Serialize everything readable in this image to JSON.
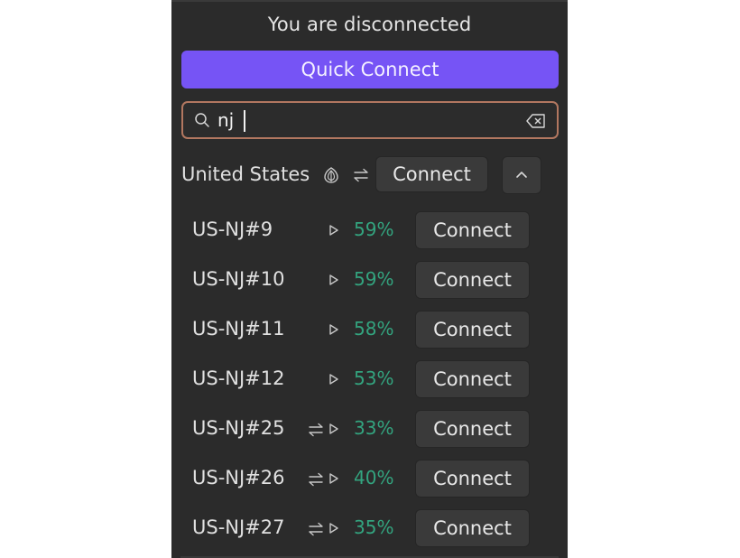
{
  "status": "You are disconnected",
  "quick_connect_label": "Quick Connect",
  "search": {
    "value": "nj",
    "icon": "search-icon",
    "clear_icon": "backspace-clear-icon"
  },
  "country": {
    "name": "United States",
    "features": [
      "tor-onion-icon",
      "p2p-arrows-icon"
    ],
    "connect_label": "Connect",
    "collapse_icon": "chevron-up-icon"
  },
  "servers": [
    {
      "name": "US-NJ#9",
      "p2p": false,
      "load": "59%",
      "connect_label": "Connect"
    },
    {
      "name": "US-NJ#10",
      "p2p": false,
      "load": "59%",
      "connect_label": "Connect"
    },
    {
      "name": "US-NJ#11",
      "p2p": false,
      "load": "58%",
      "connect_label": "Connect"
    },
    {
      "name": "US-NJ#12",
      "p2p": false,
      "load": "53%",
      "connect_label": "Connect"
    },
    {
      "name": "US-NJ#25",
      "p2p": true,
      "load": "33%",
      "connect_label": "Connect"
    },
    {
      "name": "US-NJ#26",
      "p2p": true,
      "load": "40%",
      "connect_label": "Connect"
    },
    {
      "name": "US-NJ#27",
      "p2p": true,
      "load": "35%",
      "connect_label": "Connect"
    }
  ],
  "colors": {
    "accent": "#7654f5",
    "load_green": "#33a47f",
    "panel_bg": "#2b2b2b",
    "search_border": "#b27760"
  }
}
